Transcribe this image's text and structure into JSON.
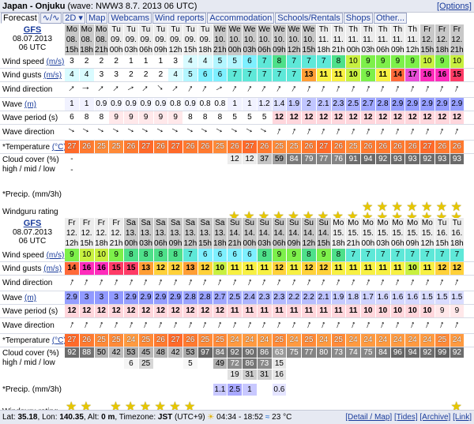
{
  "header": {
    "location": "Japan - Onjuku",
    "info": "(wave: NWW3 8.7. 2013 06 UTC)",
    "options": "[Options]"
  },
  "tabs": [
    {
      "label": "Forecast",
      "sel": true
    },
    {
      "label": "∿/∿"
    },
    {
      "label": "2D ▾"
    },
    {
      "label": "Map"
    },
    {
      "label": "Webcams"
    },
    {
      "label": "Wind reports"
    },
    {
      "label": "Accommodation"
    },
    {
      "label": "Schools/Rentals"
    },
    {
      "label": "Shops"
    },
    {
      "label": "Other..."
    }
  ],
  "labels": {
    "model": "GFS",
    "date": "08.07.2013",
    "run": "06 UTC",
    "wind_speed": "Wind speed",
    "wind_gusts": "Wind gusts",
    "unit_ms": "(m/s)",
    "wind_dir": "Wind direction",
    "wave": "Wave",
    "unit_m": "(m)",
    "wave_period": "Wave period (s)",
    "wave_dir": "Wave direction",
    "temperature": "*Temperature",
    "unit_c": "(°C)",
    "cloud": "Cloud cover (%) high / mid / low",
    "precip": "*Precip. (mm/3h)",
    "rating": "Windguru rating"
  },
  "colors": {
    "weekend": "#c8c8c8",
    "weekday": "#ececec"
  },
  "blocks": [
    {
      "days": [
        "Mo",
        "Mo",
        "Mo",
        "Tu",
        "Tu",
        "Tu",
        "Tu",
        "Tu",
        "Tu",
        "Tu",
        "We",
        "We",
        "We",
        "We",
        "We",
        "We",
        "We",
        "Th",
        "Th",
        "Th",
        "Th",
        "Th",
        "Th",
        "Th",
        "Fr",
        "Fr",
        "Fr"
      ],
      "dates": [
        "08.",
        "08.",
        "08.",
        "09.",
        "09.",
        "09.",
        "09.",
        "09.",
        "09.",
        "09.",
        "10.",
        "10.",
        "10.",
        "10.",
        "10.",
        "10.",
        "10.",
        "11.",
        "11.",
        "11.",
        "11.",
        "11.",
        "11.",
        "11.",
        "12.",
        "12.",
        "12."
      ],
      "hours": [
        "15h",
        "18h",
        "21h",
        "00h",
        "03h",
        "06h",
        "09h",
        "12h",
        "15h",
        "18h",
        "21h",
        "00h",
        "03h",
        "06h",
        "09h",
        "12h",
        "15h",
        "18h",
        "21h",
        "00h",
        "03h",
        "06h",
        "09h",
        "12h",
        "15h",
        "18h",
        "21h"
      ],
      "weekend": [
        1,
        1,
        1,
        0,
        0,
        0,
        0,
        0,
        0,
        0,
        1,
        1,
        1,
        1,
        1,
        1,
        1,
        0,
        0,
        0,
        0,
        0,
        0,
        0,
        1,
        1,
        1
      ],
      "speed": [
        "3",
        "2",
        "2",
        "2",
        "1",
        "1",
        "1",
        "3",
        "4",
        "4",
        "5",
        "5",
        "6",
        "7",
        "8",
        "7",
        "7",
        "7",
        "8",
        "10",
        "9",
        "9",
        "9",
        "9",
        "10",
        "9",
        "10"
      ],
      "gusts": [
        "4",
        "4",
        "3",
        "3",
        "2",
        "2",
        "2",
        "4",
        "5",
        "6",
        "6",
        "7",
        "7",
        "7",
        "7",
        "7",
        "13",
        "11",
        "11",
        "10",
        "9",
        "11",
        "14",
        "17",
        "16",
        "16",
        "15"
      ],
      "wind_dir": [
        45,
        90,
        45,
        45,
        60,
        45,
        135,
        45,
        30,
        30,
        60,
        30,
        30,
        30,
        30,
        30,
        20,
        20,
        20,
        20,
        20,
        20,
        20,
        20,
        20,
        20,
        20
      ],
      "wave": [
        "1",
        "1",
        "0.9",
        "0.9",
        "0.9",
        "0.9",
        "0.9",
        "0.8",
        "0.9",
        "0.8",
        "0.8",
        "1",
        "1",
        "1.2",
        "1.4",
        "1.9",
        "2",
        "2.1",
        "2.3",
        "2.5",
        "2.7",
        "2.8",
        "2.9",
        "2.9",
        "2.9",
        "2.9",
        "2.9"
      ],
      "period": [
        "6",
        "8",
        "8",
        "9",
        "9",
        "9",
        "9",
        "9",
        "8",
        "8",
        "8",
        "5",
        "5",
        "5",
        "12",
        "12",
        "12",
        "12",
        "12",
        "12",
        "12",
        "12",
        "12",
        "12",
        "12",
        "12",
        "12"
      ],
      "wave_dir": [
        120,
        120,
        120,
        120,
        120,
        120,
        120,
        120,
        120,
        120,
        120,
        120,
        120,
        120,
        20,
        20,
        20,
        20,
        20,
        20,
        20,
        20,
        20,
        20,
        20,
        20,
        20
      ],
      "temp": [
        "27",
        "26",
        "25",
        "25",
        "26",
        "27",
        "26",
        "27",
        "26",
        "26",
        "25",
        "26",
        "27",
        "26",
        "25",
        "25",
        "26",
        "27",
        "26",
        "25",
        "26",
        "26",
        "26",
        "26",
        "27",
        "26",
        "26"
      ],
      "cloud_high": [
        "-",
        "",
        "",
        "",
        "",
        "",
        "",
        "",
        "",
        "",
        "",
        "12",
        "12",
        "37",
        "59",
        "84",
        "79",
        "77",
        "76",
        "91",
        "94",
        "92",
        "93",
        "93",
        "92",
        "93",
        "93"
      ],
      "cloud_mid": [
        "-",
        "",
        "",
        "",
        "",
        "",
        "",
        "",
        "",
        "",
        "",
        "",
        "",
        "",
        "",
        "",
        "",
        "",
        "",
        "",
        "",
        "",
        "",
        "",
        "",
        "",
        ""
      ],
      "precip": [
        "",
        "",
        "",
        "",
        "",
        "",
        "",
        "",
        "",
        "",
        "",
        "",
        "",
        "",
        "",
        "",
        "",
        "",
        "",
        "",
        "",
        "",
        "",
        "",
        "",
        "",
        ""
      ],
      "stars": [
        0,
        0,
        0,
        0,
        0,
        0,
        0,
        0,
        0,
        0,
        0,
        1,
        1,
        1,
        1,
        1,
        1,
        1,
        1,
        1,
        2,
        2,
        2,
        2,
        2,
        2,
        2
      ]
    },
    {
      "days": [
        "Fr",
        "Fr",
        "Fr",
        "Fr",
        "Sa",
        "Sa",
        "Sa",
        "Sa",
        "Sa",
        "Sa",
        "Sa",
        "Su",
        "Su",
        "Su",
        "Su",
        "Su",
        "Su",
        "Su",
        "Mo",
        "Mo",
        "Mo",
        "Mo",
        "Mo",
        "Mo",
        "Mo",
        "Tu",
        "Tu"
      ],
      "dates": [
        "12.",
        "12.",
        "12.",
        "12.",
        "13.",
        "13.",
        "13.",
        "13.",
        "13.",
        "13.",
        "13.",
        "14.",
        "14.",
        "14.",
        "14.",
        "14.",
        "14.",
        "14.",
        "15.",
        "15.",
        "15.",
        "15.",
        "15.",
        "15.",
        "15.",
        "16.",
        "16."
      ],
      "hours": [
        "12h",
        "15h",
        "18h",
        "21h",
        "00h",
        "03h",
        "06h",
        "09h",
        "12h",
        "15h",
        "18h",
        "21h",
        "00h",
        "03h",
        "06h",
        "09h",
        "12h",
        "15h",
        "18h",
        "21h",
        "00h",
        "03h",
        "06h",
        "09h",
        "12h",
        "15h",
        "18h"
      ],
      "weekend": [
        0,
        0,
        0,
        0,
        1,
        1,
        1,
        1,
        1,
        1,
        1,
        1,
        1,
        1,
        1,
        1,
        1,
        1,
        0,
        0,
        0,
        0,
        0,
        0,
        0,
        0,
        0
      ],
      "speed": [
        "9",
        "10",
        "10",
        "9",
        "8",
        "8",
        "8",
        "8",
        "7",
        "6",
        "6",
        "6",
        "6",
        "8",
        "9",
        "9",
        "8",
        "9",
        "8",
        "7",
        "7",
        "7",
        "7",
        "7",
        "7",
        "7",
        "7"
      ],
      "gusts": [
        "14",
        "16",
        "16",
        "15",
        "15",
        "13",
        "12",
        "12",
        "13",
        "12",
        "10",
        "11",
        "11",
        "11",
        "12",
        "11",
        "12",
        "12",
        "11",
        "11",
        "11",
        "11",
        "11",
        "10",
        "11",
        "12",
        "12"
      ],
      "wind_dir": [
        20,
        20,
        20,
        20,
        20,
        20,
        20,
        20,
        20,
        20,
        20,
        20,
        20,
        20,
        20,
        20,
        20,
        20,
        20,
        20,
        20,
        20,
        20,
        20,
        20,
        20,
        20
      ],
      "wave": [
        "2.9",
        "3",
        "3",
        "3",
        "2.9",
        "2.9",
        "2.9",
        "2.9",
        "2.8",
        "2.8",
        "2.7",
        "2.5",
        "2.4",
        "2.3",
        "2.3",
        "2.2",
        "2.2",
        "2.1",
        "1.9",
        "1.8",
        "1.7",
        "1.6",
        "1.6",
        "1.6",
        "1.5",
        "1.5",
        "1.5"
      ],
      "period": [
        "12",
        "12",
        "12",
        "12",
        "12",
        "12",
        "12",
        "12",
        "12",
        "12",
        "12",
        "11",
        "11",
        "11",
        "11",
        "11",
        "11",
        "11",
        "11",
        "11",
        "10",
        "10",
        "10",
        "10",
        "10",
        "9",
        "9"
      ],
      "wave_dir": [
        20,
        20,
        20,
        20,
        20,
        20,
        20,
        20,
        20,
        20,
        20,
        20,
        20,
        20,
        20,
        20,
        20,
        20,
        20,
        20,
        20,
        20,
        20,
        20,
        20,
        20,
        20
      ],
      "temp": [
        "27",
        "26",
        "25",
        "25",
        "24",
        "25",
        "26",
        "27",
        "26",
        "25",
        "25",
        "24",
        "24",
        "24",
        "25",
        "24",
        "25",
        "24",
        "25",
        "24",
        "24",
        "24",
        "24",
        "24",
        "24",
        "25",
        "24"
      ],
      "cloud_high": [
        "92",
        "88",
        "50",
        "42",
        "53",
        "45",
        "48",
        "42",
        "53",
        "97",
        "84",
        "92",
        "90",
        "86",
        "63",
        "75",
        "77",
        "80",
        "73",
        "74",
        "75",
        "84",
        "96",
        "94",
        "92",
        "99",
        "92"
      ],
      "cloud_mid": [
        "",
        "",
        "",
        "",
        "6",
        "25",
        "",
        "",
        "5",
        "",
        "49",
        "72",
        "86",
        "73",
        "15",
        "",
        "",
        "",
        "",
        "",
        "",
        "",
        "",
        "",
        "",
        "",
        ""
      ],
      "cloud_low": [
        "",
        "",
        "",
        "",
        "",
        "",
        "",
        "",
        "",
        "",
        "",
        "19",
        "31",
        "31",
        "16",
        "",
        "",
        "",
        "",
        "",
        "",
        "",
        "",
        "",
        "",
        "",
        ""
      ],
      "precip": [
        "",
        "",
        "",
        "",
        "",
        "",
        "",
        "",
        "",
        "",
        "1.1",
        "2.5",
        "1",
        "",
        "0.6",
        "",
        "",
        "",
        "",
        "",
        "",
        "",
        "",
        "",
        "",
        "",
        ""
      ],
      "stars": [
        2,
        2,
        1,
        2,
        2,
        2,
        2,
        2,
        2,
        1,
        1,
        1,
        1,
        1,
        1,
        1,
        1,
        1,
        1,
        1,
        1,
        1,
        1,
        1,
        1,
        1,
        2
      ]
    }
  ],
  "footer": {
    "lat_label": "Lat:",
    "lat": "35.18",
    "lon_label": "Lon:",
    "lon": "140.35",
    "alt_label": "Alt:",
    "alt": "0 m",
    "tz_label": "Timezone:",
    "tz": "JST",
    "tz_off": "(UTC+9)",
    "sun": "04:34 - 18:52",
    "water": "23 °C",
    "links": [
      "[Detail / Map]",
      "[Tides]",
      "[Archive]",
      "[Link]"
    ]
  }
}
